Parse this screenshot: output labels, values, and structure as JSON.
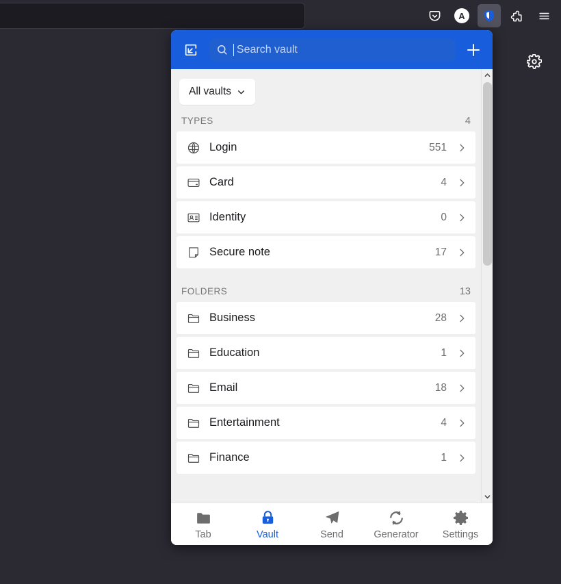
{
  "browser": {
    "urlbar_value": "",
    "toolbar_buttons": [
      {
        "name": "pocket-icon",
        "label": "Pocket"
      },
      {
        "name": "account-avatar",
        "label": "A"
      },
      {
        "name": "bitwarden-shield-icon",
        "label": "Bitwarden"
      },
      {
        "name": "extensions-icon",
        "label": "Extensions"
      },
      {
        "name": "app-menu-icon",
        "label": "Open application menu"
      }
    ],
    "page_gear_label": "Settings"
  },
  "popup": {
    "header": {
      "popout_label": "Pop out",
      "search_placeholder": "Search vault",
      "search_value": "",
      "add_label": "Add item"
    },
    "vault_filter": {
      "label": "All vaults",
      "chevron": "chevron-down-icon"
    },
    "sections": [
      {
        "title": "TYPES",
        "count": "4",
        "rows": [
          {
            "icon": "globe-icon",
            "label": "Login",
            "count": "551"
          },
          {
            "icon": "credit-card-icon",
            "label": "Card",
            "count": "4"
          },
          {
            "icon": "id-card-icon",
            "label": "Identity",
            "count": "0"
          },
          {
            "icon": "note-icon",
            "label": "Secure note",
            "count": "17"
          }
        ]
      },
      {
        "title": "FOLDERS",
        "count": "13",
        "rows": [
          {
            "icon": "folder-icon",
            "label": "Business",
            "count": "28"
          },
          {
            "icon": "folder-icon",
            "label": "Education",
            "count": "1"
          },
          {
            "icon": "folder-icon",
            "label": "Email",
            "count": "18"
          },
          {
            "icon": "folder-icon",
            "label": "Entertainment",
            "count": "4"
          },
          {
            "icon": "folder-icon",
            "label": "Finance",
            "count": "1"
          }
        ]
      }
    ],
    "footer": {
      "items": [
        {
          "icon": "folder-icon",
          "label": "Tab",
          "active": false
        },
        {
          "icon": "lock-icon",
          "label": "Vault",
          "active": true
        },
        {
          "icon": "send-icon",
          "label": "Send",
          "active": false
        },
        {
          "icon": "refresh-icon",
          "label": "Generator",
          "active": false
        },
        {
          "icon": "gear-icon",
          "label": "Settings",
          "active": false
        }
      ]
    }
  },
  "colors": {
    "brand_blue": "#175ddc",
    "chrome_dark": "#2b2a33",
    "popup_bg": "#f0f0f0",
    "row_bg": "#ffffff"
  }
}
